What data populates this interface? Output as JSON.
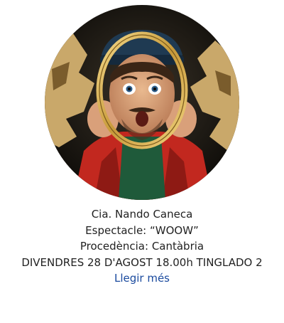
{
  "event": {
    "image": {
      "subject": "performer-portrait"
    },
    "company": "Cia. Nando Caneca",
    "show": "Espectacle: “WOOW”",
    "origin": "Procedència: Cantàbria",
    "schedule": "DIVENDRES 28 D'AGOST 18.00h TINGLADO 2",
    "more_label": "Llegir més"
  },
  "colors": {
    "link": "#1a4a9e",
    "text": "#222222",
    "background": "#ffffff"
  }
}
